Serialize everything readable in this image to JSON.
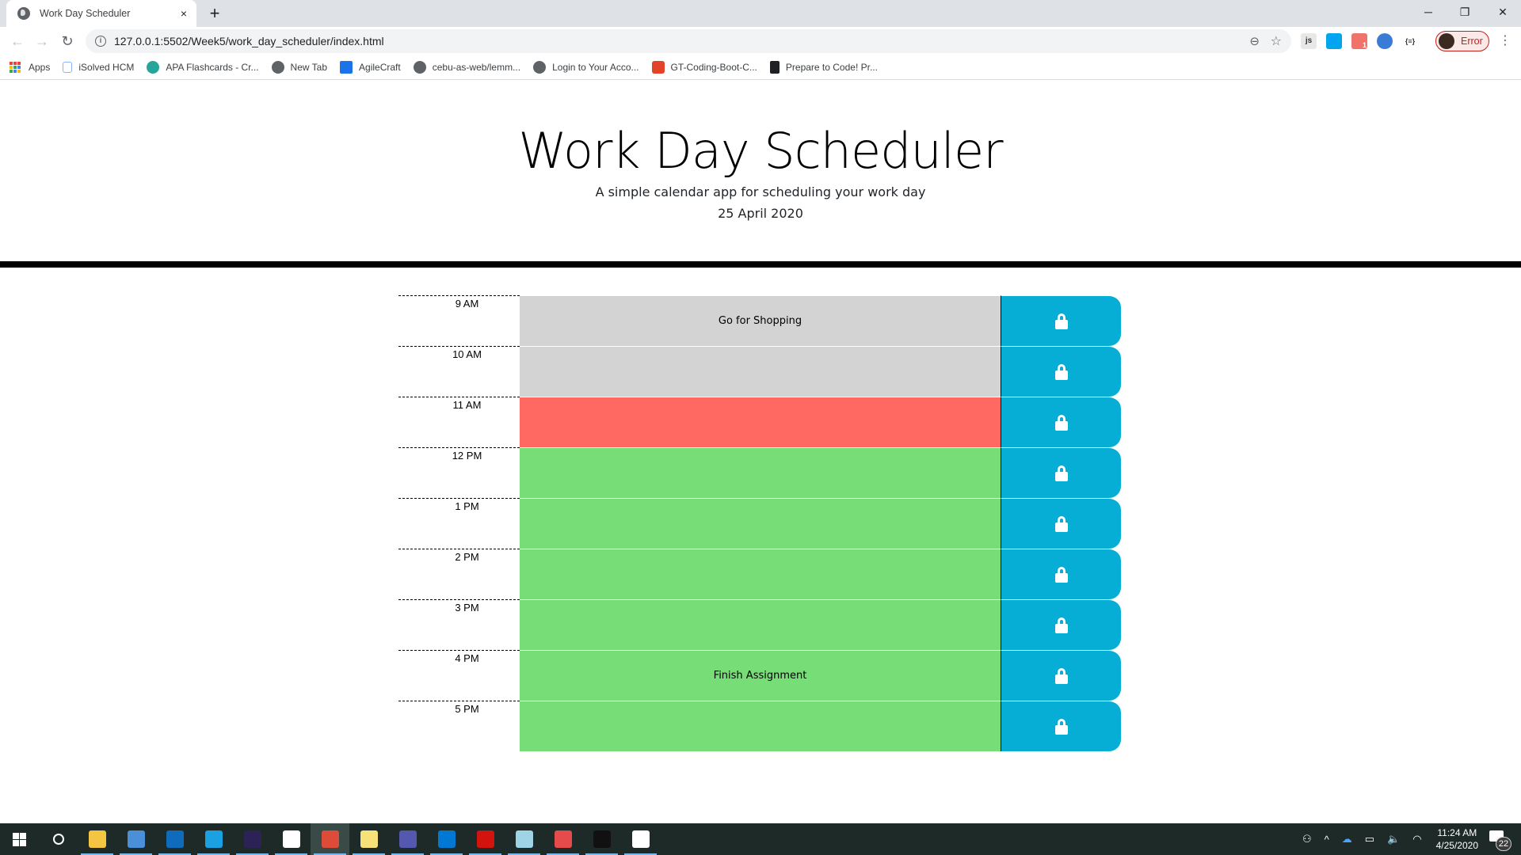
{
  "browser": {
    "tab": {
      "title": "Work Day Scheduler",
      "close_icon": "×"
    },
    "new_tab_icon": "+",
    "window_controls": {
      "minimize": "─",
      "restore": "❐",
      "close": "✕"
    },
    "nav": {
      "back": "←",
      "forward": "→",
      "reload": "↻"
    },
    "url": "127.0.0.1:5502/Week5/work_day_scheduler/index.html",
    "profile_label": "Error",
    "extensions": [
      {
        "name": "js-extension",
        "label": "js"
      },
      {
        "name": "windows-extension",
        "label": ""
      },
      {
        "name": "extension-badge",
        "label": "1"
      },
      {
        "name": "extension-circle",
        "label": ""
      },
      {
        "name": "json-extension",
        "label": "{≡}"
      }
    ],
    "bookmarks": [
      {
        "label": "Apps",
        "icon": "apps-grid-icon"
      },
      {
        "label": "iSolved HCM",
        "icon": "info-page-icon"
      },
      {
        "label": "APA Flashcards - Cr...",
        "icon": "flashcards-icon"
      },
      {
        "label": "New Tab",
        "icon": "globe-icon"
      },
      {
        "label": "AgileCraft",
        "icon": "agilecraft-icon"
      },
      {
        "label": "cebu-as-web/lemm...",
        "icon": "globe-icon"
      },
      {
        "label": "Login to Your Acco...",
        "icon": "globe-icon"
      },
      {
        "label": "GT-Coding-Boot-C...",
        "icon": "gitlab-icon"
      },
      {
        "label": "Prepare to Code! Pr...",
        "icon": "book-icon"
      }
    ]
  },
  "header": {
    "title": "Work Day Scheduler",
    "subtitle": "A simple calendar app for scheduling your work day",
    "current_date": "25 April 2020"
  },
  "schedule": {
    "colors": {
      "past": "#d3d3d3",
      "present": "#ff6961",
      "future": "#77dd77",
      "save": "#06aed5"
    },
    "rows": [
      {
        "hour": "9 AM",
        "status": "past",
        "text": "Go for Shopping"
      },
      {
        "hour": "10 AM",
        "status": "past",
        "text": ""
      },
      {
        "hour": "11 AM",
        "status": "present",
        "text": ""
      },
      {
        "hour": "12 PM",
        "status": "future",
        "text": ""
      },
      {
        "hour": "1 PM",
        "status": "future",
        "text": ""
      },
      {
        "hour": "2 PM",
        "status": "future",
        "text": ""
      },
      {
        "hour": "3 PM",
        "status": "future",
        "text": ""
      },
      {
        "hour": "4 PM",
        "status": "future",
        "text": "Finish Assignment"
      },
      {
        "hour": "5 PM",
        "status": "future",
        "text": ""
      }
    ],
    "save_icon": "lock-icon"
  },
  "taskbar": {
    "apps": [
      {
        "name": "start",
        "color": "#ffffff"
      },
      {
        "name": "search",
        "color": "#ffffff"
      },
      {
        "name": "file-explorer",
        "color": "#f4c542"
      },
      {
        "name": "remote-desktop",
        "color": "#4a8fd8"
      },
      {
        "name": "outlook",
        "color": "#0f6cbd"
      },
      {
        "name": "internet-explorer",
        "color": "#1ba1e2"
      },
      {
        "name": "eclipse",
        "color": "#2c2255"
      },
      {
        "name": "slack",
        "color": "#ffffff"
      },
      {
        "name": "chrome",
        "color": "#dd4b39",
        "active": true
      },
      {
        "name": "sticky-notes",
        "color": "#f7e27a"
      },
      {
        "name": "teams",
        "color": "#5558af"
      },
      {
        "name": "vscode",
        "color": "#0078d4"
      },
      {
        "name": "acrobat",
        "color": "#d3130e"
      },
      {
        "name": "notepad",
        "color": "#9fd3e6"
      },
      {
        "name": "snipping-tool",
        "color": "#e54b4b"
      },
      {
        "name": "terminal",
        "color": "#111111"
      },
      {
        "name": "photos",
        "color": "#ffffff"
      }
    ],
    "clock_time": "11:24 AM",
    "clock_date": "4/25/2020",
    "notification_count": "22"
  }
}
